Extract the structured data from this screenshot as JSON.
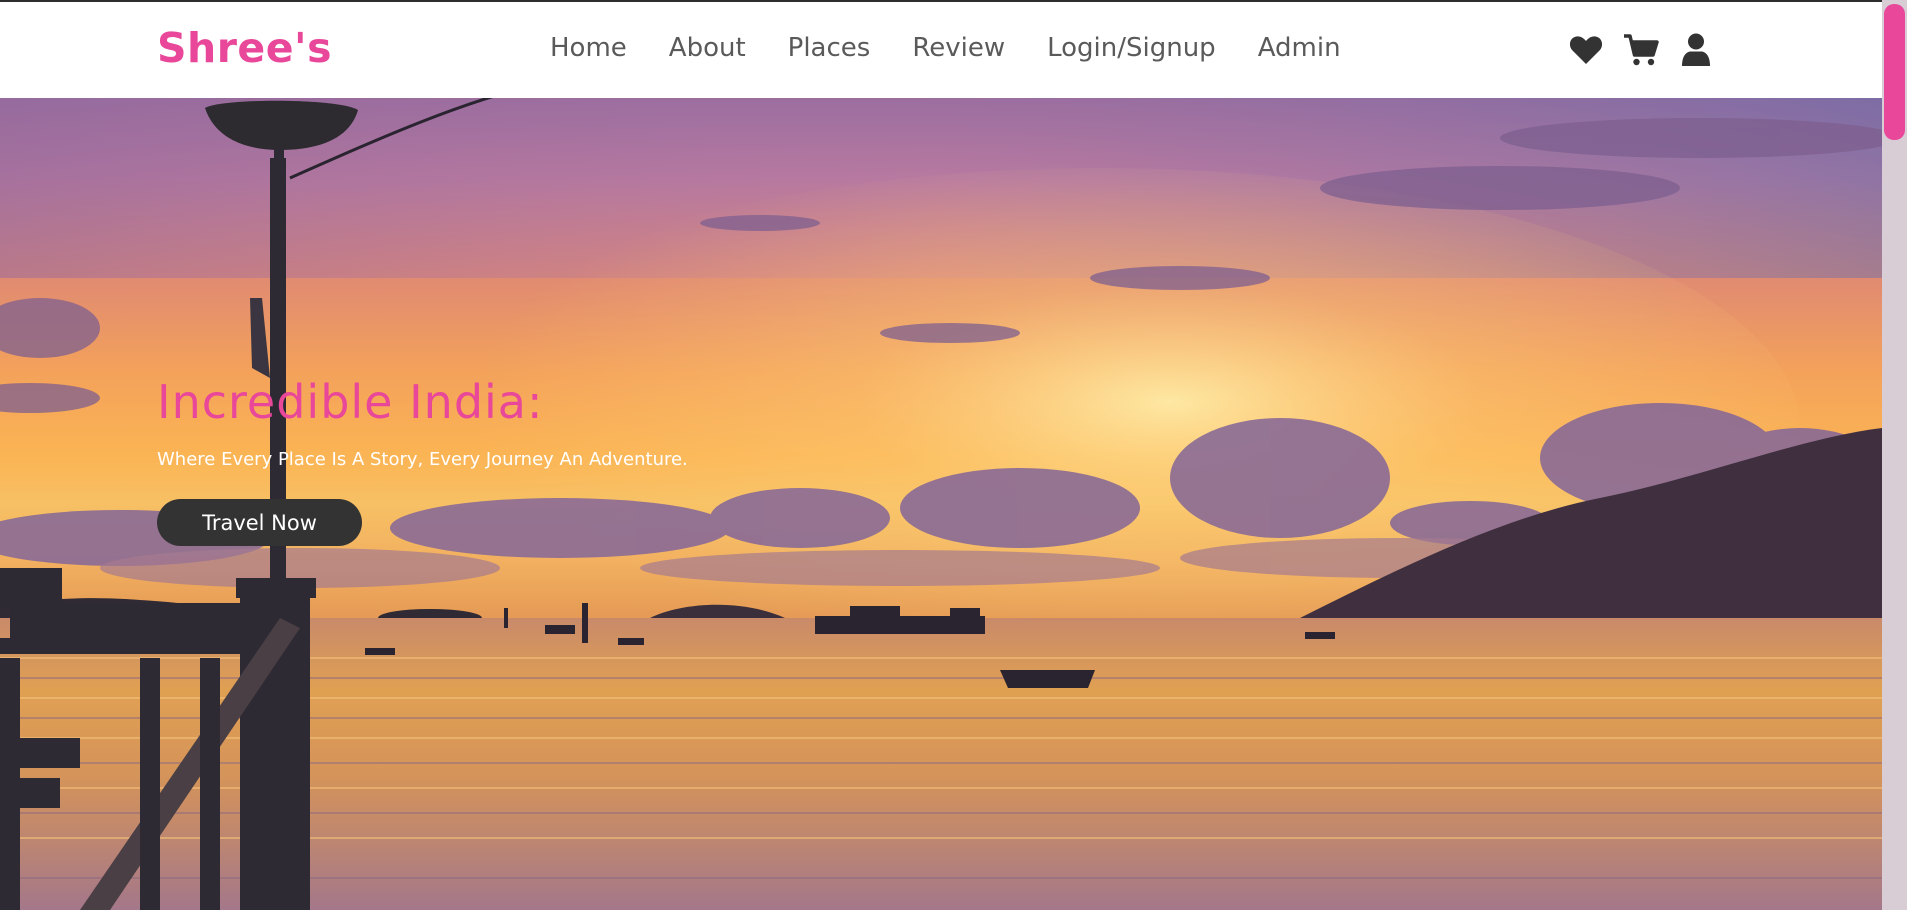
{
  "brand": {
    "logo_text": "Shree's"
  },
  "nav": {
    "links": [
      {
        "label": "Home"
      },
      {
        "label": "About"
      },
      {
        "label": "Places"
      },
      {
        "label": "Review"
      },
      {
        "label": "Login/Signup"
      },
      {
        "label": "Admin"
      }
    ],
    "icons": [
      "heart-icon",
      "cart-icon",
      "user-icon"
    ]
  },
  "hero": {
    "title": "Incredible India:",
    "subtitle": "Where Every Place Is A Story, Every Journey An Adventure.",
    "button_label": "Travel Now"
  },
  "colors": {
    "accent": "#e8479a",
    "nav_text": "#5a5a5a",
    "button_bg": "#333333",
    "icon": "#333333"
  }
}
